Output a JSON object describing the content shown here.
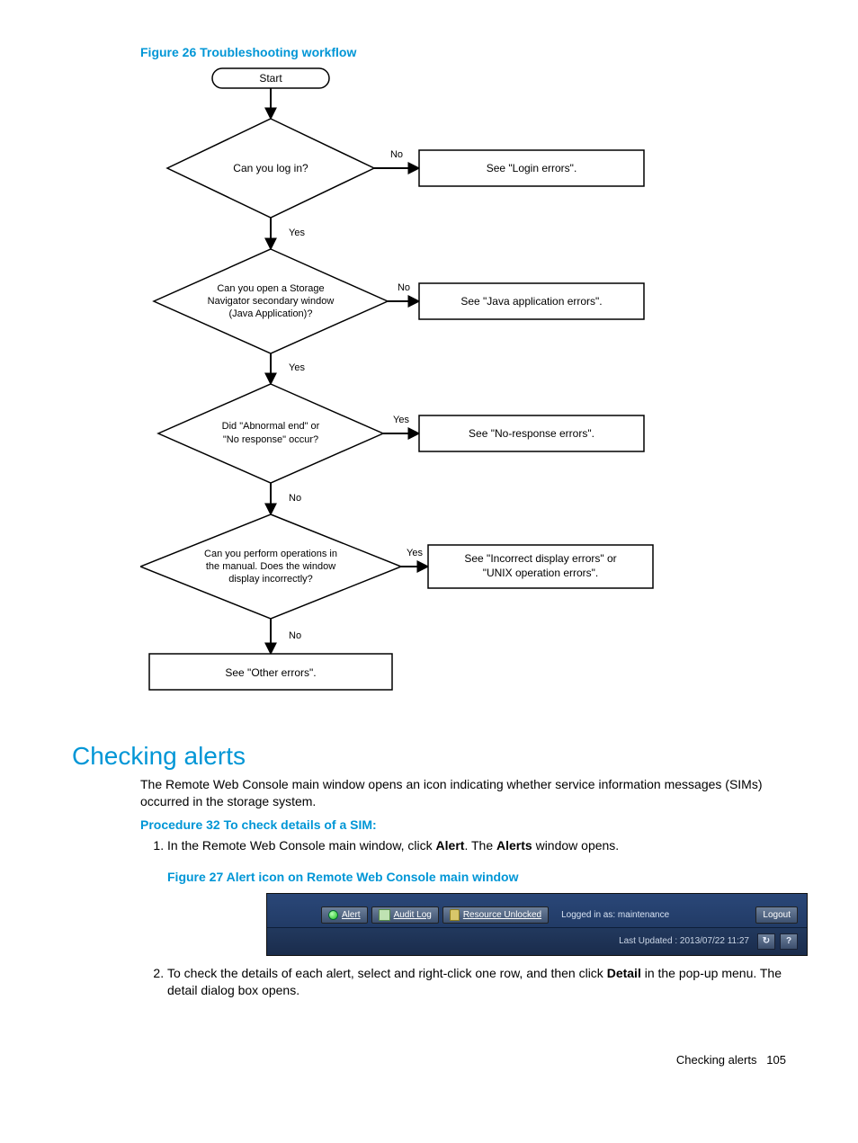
{
  "figure26": {
    "caption": "Figure 26 Troubleshooting workflow",
    "start": "Start",
    "d1": "Can you log in?",
    "d1_no": "No",
    "d1_yes": "Yes",
    "r1": "See \"Login errors\".",
    "d2a": "Can you open a Storage",
    "d2b": "Navigator secondary window",
    "d2c": "(Java Application)?",
    "d2_no": "No",
    "d2_yes": "Yes",
    "r2": "See \"Java application errors\".",
    "d3a": "Did \"Abnormal end\" or",
    "d3b": "\"No response\" occur?",
    "d3_yes": "Yes",
    "d3_no": "No",
    "r3": "See \"No-response errors\".",
    "d4a": "Can you perform operations in",
    "d4b": "the manual.  Does the window",
    "d4c": "display incorrectly?",
    "d4_yes": "Yes",
    "r4a": "See \"Incorrect display errors\" or",
    "r4b": "\"UNIX operation errors\".",
    "d4_no": "No",
    "r5": "See \"Other errors\"."
  },
  "section_heading": "Checking alerts",
  "intro": "The Remote Web Console main window opens an icon indicating whether service information messages (SIMs) occurred in the storage system.",
  "procedure_caption": "Procedure 32 To check details of a SIM:",
  "step1_a": "In the Remote Web Console main window, click ",
  "step1_b_bold": "Alert",
  "step1_c": ". The ",
  "step1_d_bold": "Alerts",
  "step1_e": " window opens.",
  "figure27_caption": "Figure 27 Alert icon on Remote Web Console main window",
  "toolbar": {
    "alert": "Alert",
    "audit": "Audit Log",
    "resource": "Resource Unlocked",
    "logged_in": "Logged in as: maintenance",
    "logout": "Logout",
    "last_updated": "Last Updated : 2013/07/22 11:27",
    "refresh_glyph": "↻",
    "help_glyph": "?"
  },
  "step2_a": "To check the details of each alert, select and right-click one row, and then click ",
  "step2_b_bold": "Detail",
  "step2_c": " in the pop-up menu. The detail dialog box opens.",
  "footer_label": "Checking alerts",
  "footer_page": "105",
  "chart_data": {
    "type": "flowchart",
    "title": "Troubleshooting workflow",
    "nodes": [
      {
        "id": "start",
        "type": "terminator",
        "text": "Start"
      },
      {
        "id": "d1",
        "type": "decision",
        "text": "Can you log in?"
      },
      {
        "id": "r1",
        "type": "process",
        "text": "See \"Login errors\"."
      },
      {
        "id": "d2",
        "type": "decision",
        "text": "Can you open a Storage Navigator secondary window (Java Application)?"
      },
      {
        "id": "r2",
        "type": "process",
        "text": "See \"Java application errors\"."
      },
      {
        "id": "d3",
        "type": "decision",
        "text": "Did \"Abnormal end\" or \"No response\" occur?"
      },
      {
        "id": "r3",
        "type": "process",
        "text": "See \"No-response errors\"."
      },
      {
        "id": "d4",
        "type": "decision",
        "text": "Can you perform operations in the manual. Does the window display incorrectly?"
      },
      {
        "id": "r4",
        "type": "process",
        "text": "See \"Incorrect display errors\" or \"UNIX operation errors\"."
      },
      {
        "id": "r5",
        "type": "process",
        "text": "See \"Other errors\"."
      }
    ],
    "edges": [
      {
        "from": "start",
        "to": "d1"
      },
      {
        "from": "d1",
        "to": "r1",
        "label": "No"
      },
      {
        "from": "d1",
        "to": "d2",
        "label": "Yes"
      },
      {
        "from": "d2",
        "to": "r2",
        "label": "No"
      },
      {
        "from": "d2",
        "to": "d3",
        "label": "Yes"
      },
      {
        "from": "d3",
        "to": "r3",
        "label": "Yes"
      },
      {
        "from": "d3",
        "to": "d4",
        "label": "No"
      },
      {
        "from": "d4",
        "to": "r4",
        "label": "Yes"
      },
      {
        "from": "d4",
        "to": "r5",
        "label": "No"
      }
    ]
  }
}
